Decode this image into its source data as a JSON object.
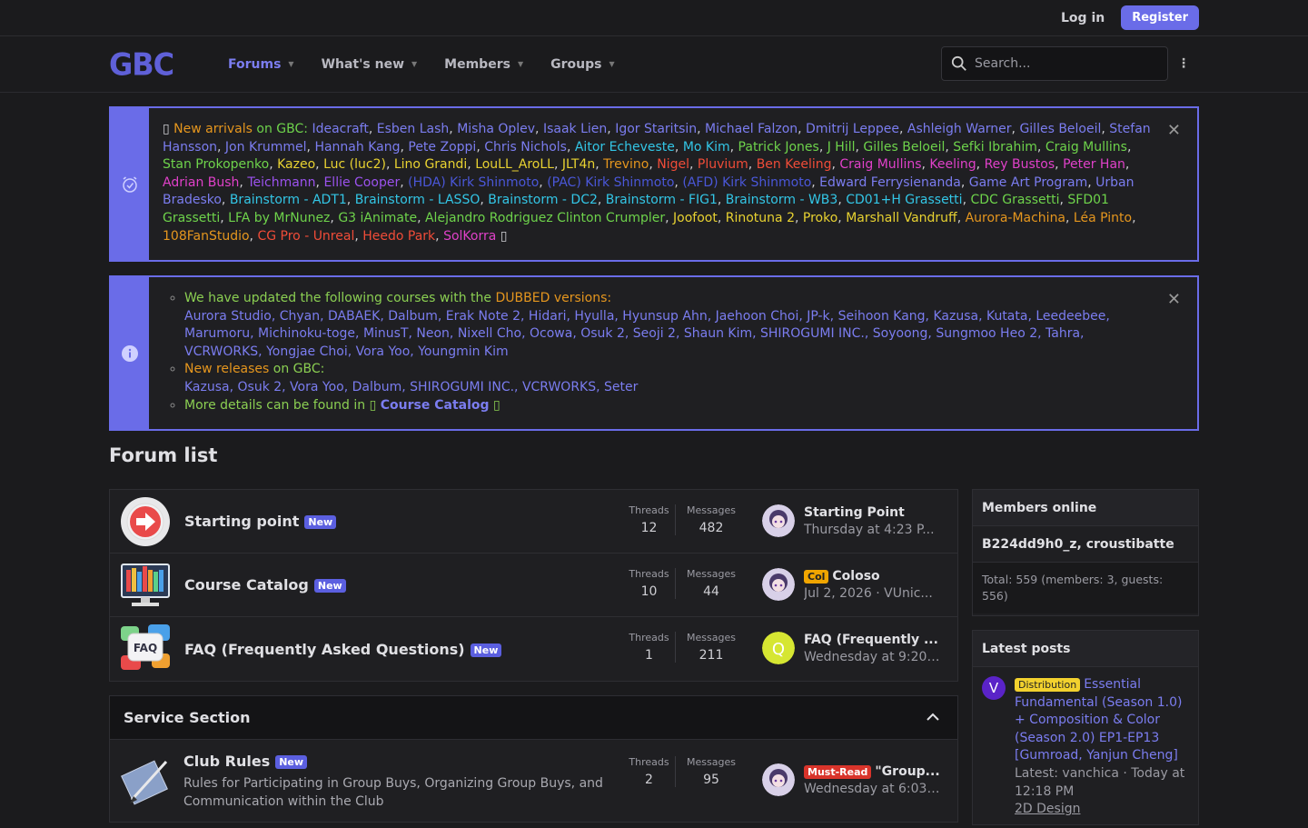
{
  "topbar": {
    "login": "Log in",
    "register": "Register"
  },
  "logo": "GBC",
  "nav": [
    {
      "label": "Forums"
    },
    {
      "label": "What's new"
    },
    {
      "label": "Members"
    },
    {
      "label": "Groups"
    }
  ],
  "search": {
    "placeholder": "Search..."
  },
  "notice1": {
    "prefix": "New arrivals",
    "on": " on GBC: ",
    "names": [
      {
        "t": "Ideacraft",
        "c": "c-blue"
      },
      {
        "t": "Esben Lash",
        "c": "c-blue"
      },
      {
        "t": "Misha Oplev",
        "c": "c-blue"
      },
      {
        "t": "Isaak Lien",
        "c": "c-blue"
      },
      {
        "t": "Igor Staritsin",
        "c": "c-blue"
      },
      {
        "t": "Michael Falzon",
        "c": "c-blue"
      },
      {
        "t": "Dmitrij Leppee",
        "c": "c-blue"
      },
      {
        "t": "Ashleigh Warner",
        "c": "c-blue"
      },
      {
        "t": "Gilles Beloeil",
        "c": "c-blue"
      },
      {
        "t": "Stefan Hansson",
        "c": "c-blue"
      },
      {
        "t": "Jon Krummel",
        "c": "c-blue"
      },
      {
        "t": "Hannah Kang",
        "c": "c-blue"
      },
      {
        "t": "Pete Zoppi",
        "c": "c-blue"
      },
      {
        "t": "Chris Nichols",
        "c": "c-blue"
      },
      {
        "t": "Aitor Echeveste",
        "c": "c-cyan"
      },
      {
        "t": "Mo Kim",
        "c": "c-cyan"
      },
      {
        "t": "Patrick Jones",
        "c": "c-lime"
      },
      {
        "t": "J Hill",
        "c": "c-lime"
      },
      {
        "t": "Gilles Beloeil",
        "c": "c-lime"
      },
      {
        "t": "Sefki Ibrahim",
        "c": "c-lime"
      },
      {
        "t": "Craig Mullins",
        "c": "c-lime"
      },
      {
        "t": "Stan Prokopenko",
        "c": "c-lime"
      },
      {
        "t": "Kazeo",
        "c": "c-yellow"
      },
      {
        "t": "Luc (luc2)",
        "c": "c-yellow"
      },
      {
        "t": "Lino Grandi",
        "c": "c-yellow"
      },
      {
        "t": "LouLL_AroLL",
        "c": "c-yellow"
      },
      {
        "t": "JLT4n",
        "c": "c-yellow"
      },
      {
        "t": "Trevino",
        "c": "c-orange"
      },
      {
        "t": "Nigel",
        "c": "c-red"
      },
      {
        "t": "Pluvium",
        "c": "c-red"
      },
      {
        "t": "Ben Keeling",
        "c": "c-red"
      },
      {
        "t": "Craig Mullins",
        "c": "c-magenta"
      },
      {
        "t": "Keeling",
        "c": "c-magenta"
      },
      {
        "t": "Rey Bustos",
        "c": "c-magenta"
      },
      {
        "t": "Peter Han",
        "c": "c-magenta"
      },
      {
        "t": "Adrian Bush",
        "c": "c-magenta"
      },
      {
        "t": "Teichmann",
        "c": "c-purple"
      },
      {
        "t": "Ellie Cooper",
        "c": "c-purple"
      },
      {
        "t": "(HDA) Kirk Shinmoto",
        "c": "c-dblue"
      },
      {
        "t": "(PAC) Kirk Shinmoto",
        "c": "c-dblue"
      },
      {
        "t": "(AFD) Kirk Shinmoto",
        "c": "c-dblue"
      },
      {
        "t": "Edward Ferrysienanda",
        "c": "c-blue"
      },
      {
        "t": "Game Art Program",
        "c": "c-blue"
      },
      {
        "t": "Urban Bradesko",
        "c": "c-blue"
      },
      {
        "t": "Brainstorm - ADT1",
        "c": "c-cyan"
      },
      {
        "t": "Brainstorm - LASSO",
        "c": "c-cyan"
      },
      {
        "t": "Brainstorm - DC2",
        "c": "c-cyan"
      },
      {
        "t": "Brainstorm - FIG1",
        "c": "c-cyan"
      },
      {
        "t": "Brainstorm - WB3",
        "c": "c-cyan"
      },
      {
        "t": "CD01+H Grassetti",
        "c": "c-cyan"
      },
      {
        "t": "CDC Grassetti",
        "c": "c-lime"
      },
      {
        "t": "SFD01 Grassetti",
        "c": "c-lime"
      },
      {
        "t": "LFA by MrNunez",
        "c": "c-lime"
      },
      {
        "t": "G3 iAnimate",
        "c": "c-lime"
      },
      {
        "t": "Alejandro Rodriguez Clinton Crumpler",
        "c": "c-lime"
      },
      {
        "t": "Joofoot",
        "c": "c-yellow"
      },
      {
        "t": "Rinotuna 2",
        "c": "c-yellow"
      },
      {
        "t": "Proko",
        "c": "c-yellow"
      },
      {
        "t": "Marshall Vandruff",
        "c": "c-yellow"
      },
      {
        "t": "Aurora-Machina",
        "c": "c-orange"
      },
      {
        "t": "Léa Pinto",
        "c": "c-orange"
      },
      {
        "t": "108FanStudio",
        "c": "c-orange"
      },
      {
        "t": "CG Pro - Unreal",
        "c": "c-red"
      },
      {
        "t": "Heedo Park",
        "c": "c-red"
      },
      {
        "t": "SolKorra",
        "c": "c-magenta"
      }
    ]
  },
  "notice2": {
    "line1": "We have updated the following courses with the ",
    "dubbed": "DUBBED versions:",
    "dubbed_list": "Aurora Studio, Chyan, DABAEK, Dalbum, Erak Note 2, Hidari, Hyulla, Hyunsup Ahn, Jaehoon Choi, JP-k, Seihoon Kang, Kazusa, Kutata, Leedeebee, Marumoru, Michinoku-toge, MinusT, Neon, Nixell Cho, Ocowa, Osuk 2, Seoji 2, Shaun Kim, SHIROGUMI INC., Soyoong, Sungmoo Heo 2, Tahra, VCRWORKS, Yongjae Choi, Vora Yoo, Youngmin Kim",
    "line2a": "New releases",
    "line2b": " on GBC:",
    "release_list": "Kazusa, Osuk 2, Vora Yoo, Dalbum, SHIROGUMI INC., VCRWORKS, Seter",
    "line3": "More details can be found in ",
    "catalog": "Course Catalog"
  },
  "forum_list_title": "Forum list",
  "forums": [
    {
      "title": "Starting point",
      "badge": "New",
      "threads_label": "Threads",
      "threads": "12",
      "messages_label": "Messages",
      "messages": "482",
      "last_title": "Starting Point",
      "last_prefix": "",
      "last_sub": "Thursday at 4:23 P..."
    },
    {
      "title": "Course Catalog",
      "badge": "New",
      "threads_label": "Threads",
      "threads": "10",
      "messages_label": "Messages",
      "messages": "44",
      "last_title": "Coloso",
      "last_prefix": "Col",
      "last_sub": "Jul 2, 2026 · VUnic..."
    },
    {
      "title": "FAQ (Frequently Asked Questions)",
      "badge": "New",
      "threads_label": "Threads",
      "threads": "1",
      "messages_label": "Messages",
      "messages": "211",
      "last_title": "FAQ (Frequently ...",
      "last_prefix": "",
      "last_sub": "Wednesday at 9:20 ..."
    }
  ],
  "service": {
    "title": "Service Section",
    "forum": {
      "title": "Club Rules",
      "badge": "New",
      "desc": "Rules for Participating in Group Buys, Organizing Group Buys, and Communication within the Club",
      "threads_label": "Threads",
      "threads": "2",
      "messages_label": "Messages",
      "messages": "95",
      "last_prefix": "Must-Read",
      "last_title": "\"Group...",
      "last_sub": "Wednesday at 6:03 ..."
    }
  },
  "members_online": {
    "title": "Members online",
    "users": "B224dd9h0_z, croustibatte",
    "total": "Total: 559 (members: 3, guests: 556)"
  },
  "latest_posts": {
    "title": "Latest posts",
    "avatar_letter": "V",
    "prefix": "Distribution",
    "post_title": "Essential Fundamental (Season 1.0) + Composition & Color (Season 2.0) EP1-EP13 [Gumroad, Yanjun Cheng]",
    "meta": "Latest: vanchica · Today at 12:18 PM",
    "forum": "2D Design"
  }
}
